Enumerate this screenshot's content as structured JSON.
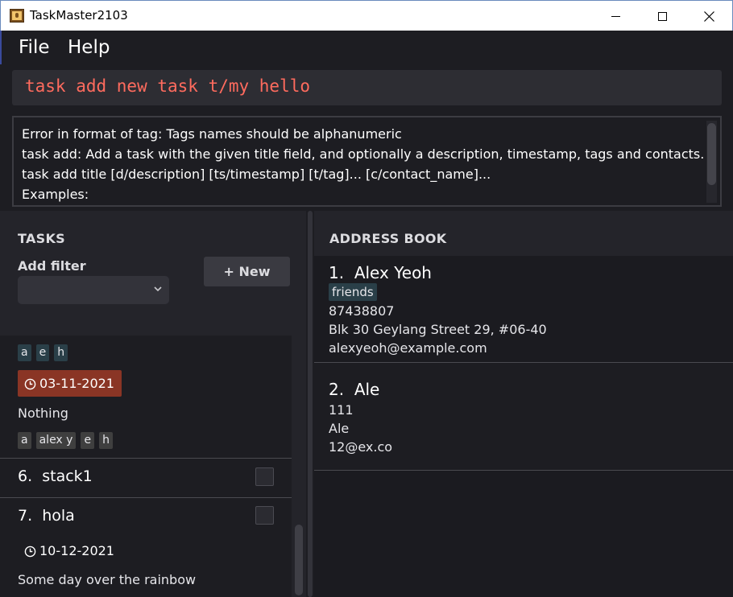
{
  "window": {
    "title": "TaskMaster2103"
  },
  "menu": {
    "file": "File",
    "help": "Help"
  },
  "command": {
    "value": "task add new task t/my hello"
  },
  "result": {
    "lines": [
      "Error in format of tag: Tags names should be alphanumeric",
      "task add: Add a task with the given title field, and optionally a description, timestamp, tags and contacts.",
      "task add title [d/description] [ts/timestamp] [t/tag]... [c/contact_name]...",
      "Examples:"
    ]
  },
  "tasks_panel": {
    "heading": "TASKS",
    "filter_label": "Add filter",
    "filter_value": "",
    "new_button": "+ New",
    "partial_task": {
      "tags": [
        "a",
        "e",
        "h"
      ],
      "date": "03-11-2021",
      "description": "Nothing",
      "contacts": [
        "a",
        "alex y",
        "e",
        "h"
      ]
    },
    "tasks": [
      {
        "index": "6.",
        "title": "stack1"
      },
      {
        "index": "7.",
        "title": "hola",
        "date": "10-12-2021",
        "description": "Some day over the rainbow"
      }
    ]
  },
  "address_book": {
    "heading": "ADDRESS BOOK",
    "persons": [
      {
        "index": "1.",
        "name": "Alex Yeoh",
        "tag": "friends",
        "phone": "87438807",
        "address": "Blk 30 Geylang Street 29, #06-40",
        "email": "alexyeoh@example.com"
      },
      {
        "index": "2.",
        "name": "Ale",
        "phone": "111",
        "address": "Ale",
        "email": "12@ex.co"
      }
    ]
  },
  "colors": {
    "background": "#1d1d22",
    "command_text": "#ff6b5e",
    "overdue_badge": "#8a3525",
    "tag_teal": "#2a3f48"
  },
  "icons": [
    "app-icon",
    "minimize-icon",
    "maximize-icon",
    "close-icon",
    "chevron-down-icon",
    "clock-icon"
  ]
}
